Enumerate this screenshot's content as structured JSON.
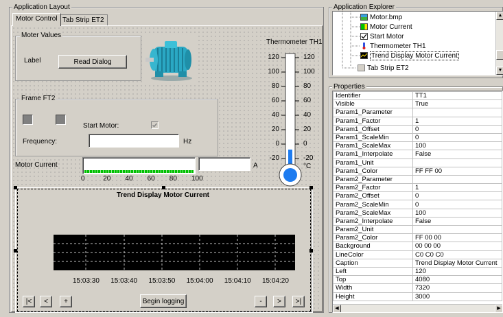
{
  "app_layout": {
    "title": "Application Layout"
  },
  "tabs": [
    {
      "label": "Motor Control",
      "active": true
    },
    {
      "label": "Tab Strip ET2",
      "active": false
    }
  ],
  "moter_values": {
    "title": "Moter Values",
    "label_text": "Label",
    "read_dialog_button": "Read Dialog"
  },
  "thermometer": {
    "title": "Thermometer TH1",
    "scale_left": [
      "120",
      "100",
      "80",
      "60",
      "40",
      "20",
      "0",
      "-20"
    ],
    "scale_right": [
      "120",
      "100",
      "80",
      "60",
      "40",
      "20",
      "0",
      "-20"
    ],
    "unit": "°C"
  },
  "frame_ft2": {
    "title": "Frame FT2",
    "start_motor_label": "Start Motor:",
    "frequency_label": "Frequency:",
    "frequency_value": "",
    "frequency_unit": "Hz"
  },
  "motor_current": {
    "label": "Motor Current",
    "unit": "A",
    "value_text": "",
    "scale": [
      "0",
      "20",
      "40",
      "60",
      "80",
      "100"
    ]
  },
  "trend": {
    "title": "Trend Display Motor Current",
    "time_labels": [
      "15:03:30",
      "15:03:40",
      "15:03:50",
      "15:04:00",
      "15:04:10",
      "15:04:20"
    ],
    "begin_logging_button": "Begin logging",
    "nav_first": "|<",
    "nav_prev": "<",
    "nav_plus": "+",
    "nav_minus": "-",
    "nav_next": ">",
    "nav_last": ">|"
  },
  "explorer": {
    "title": "Application Explorer",
    "items": [
      {
        "label": "Motor.bmp",
        "icon": "bitmap-icon"
      },
      {
        "label": "Motor Current",
        "icon": "bar-icon"
      },
      {
        "label": "Start Motor",
        "icon": "checkbox-icon"
      },
      {
        "label": "Thermometer TH1",
        "icon": "thermometer-icon"
      },
      {
        "label": "Trend Display Motor Current",
        "icon": "trend-icon",
        "selected": true
      },
      {
        "label": "Tab Strip ET2",
        "icon": "tab-strip-icon"
      }
    ]
  },
  "properties": {
    "title": "Properties",
    "rows": [
      [
        "Identifier",
        "TT1"
      ],
      [
        "Visible",
        "True"
      ],
      [
        "Param1_Parameter",
        ""
      ],
      [
        "Param1_Factor",
        "1"
      ],
      [
        "Param1_Offset",
        "0"
      ],
      [
        "Param1_ScaleMin",
        "0"
      ],
      [
        "Param1_ScaleMax",
        "100"
      ],
      [
        "Param1_Interpolate",
        "False"
      ],
      [
        "Param1_Unit",
        ""
      ],
      [
        "Param1_Color",
        "FF FF 00"
      ],
      [
        "Param2_Parameter",
        ""
      ],
      [
        "Param2_Factor",
        "1"
      ],
      [
        "Param2_Offset",
        "0"
      ],
      [
        "Param2_ScaleMin",
        "0"
      ],
      [
        "Param2_ScaleMax",
        "100"
      ],
      [
        "Param2_Interpolate",
        "False"
      ],
      [
        "Param2_Unit",
        ""
      ],
      [
        "Param2_Color",
        "FF 00 00"
      ],
      [
        "Background",
        "00 00 00"
      ],
      [
        "LineColor",
        "C0 C0 C0"
      ],
      [
        "Caption",
        "Trend Display Motor Current"
      ],
      [
        "Left",
        "120"
      ],
      [
        "Top",
        "4080"
      ],
      [
        "Width",
        "7320"
      ],
      [
        "Height",
        "3000"
      ]
    ]
  },
  "colors": {
    "window_bg": "#d4d0c8",
    "trend_bg": "#000000",
    "bar_fill": "#00c000",
    "thermo_bulb": "#1e7cf0",
    "selection": "#0a246a"
  }
}
